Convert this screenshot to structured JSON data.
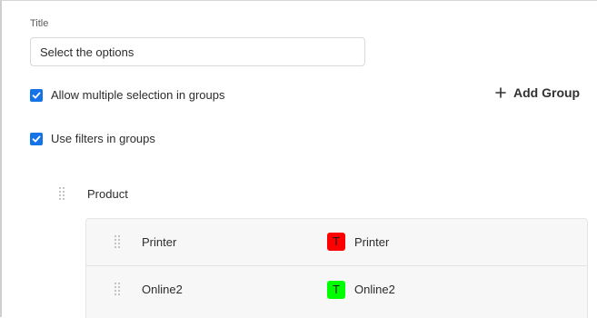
{
  "form": {
    "title_label": "Title",
    "title_value": "Select the options",
    "allow_multiple_label": "Allow multiple selection in groups",
    "allow_multiple_checked": true,
    "use_filters_label": "Use filters in groups",
    "use_filters_checked": true,
    "add_group_label": "Add Group",
    "add_group_icon": "plus-icon"
  },
  "group": {
    "name": "Product",
    "drag_icon": "drag-handle-icon",
    "items": [
      {
        "name": "Printer",
        "tag_letter": "T",
        "tag_color": "#ff0000",
        "tag_text": "Printer"
      },
      {
        "name": "Online2",
        "tag_letter": "T",
        "tag_color": "#00ff00",
        "tag_text": "Online2"
      }
    ]
  },
  "colors": {
    "accent": "#1473e6"
  }
}
